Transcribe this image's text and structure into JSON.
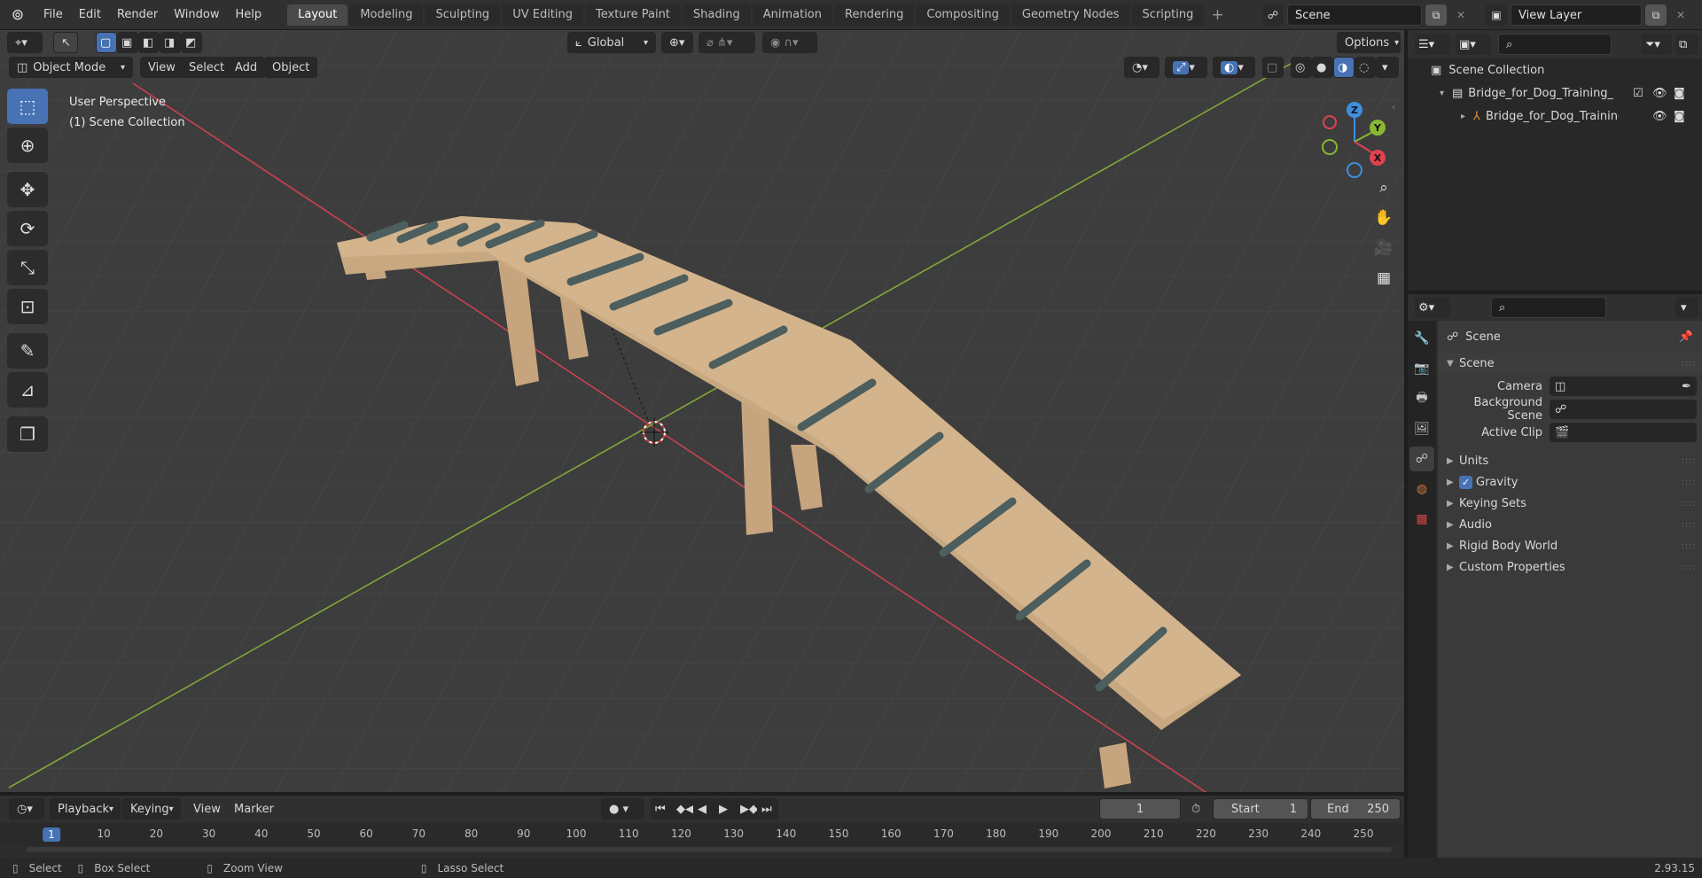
{
  "menu": {
    "items": [
      "File",
      "Edit",
      "Render",
      "Window",
      "Help"
    ]
  },
  "workspaces": [
    "Layout",
    "Modeling",
    "Sculpting",
    "UV Editing",
    "Texture Paint",
    "Shading",
    "Animation",
    "Rendering",
    "Compositing",
    "Geometry Nodes",
    "Scripting"
  ],
  "workspace_active": "Layout",
  "scene": {
    "name": "Scene",
    "view_layer": "View Layer"
  },
  "viewport": {
    "mode": "Object Mode",
    "menus": [
      "View",
      "Select",
      "Add",
      "Object"
    ],
    "transform_orientation": "Global",
    "options_label": "Options",
    "overlay_line1": "User Perspective",
    "overlay_line2": "(1) Scene Collection",
    "gizmo_axes": {
      "x": "X",
      "y": "Y",
      "z": "Z"
    }
  },
  "outliner": {
    "root": "Scene Collection",
    "collection": "Bridge_for_Dog_Training_Park",
    "object": "Bridge_for_Dog_Training"
  },
  "properties": {
    "breadcrumb": "Scene",
    "panel_scene": "Scene",
    "camera_label": "Camera",
    "background_scene_label": "Background Scene",
    "active_clip_label": "Active Clip",
    "sections": [
      "Units",
      "Gravity",
      "Keying Sets",
      "Audio",
      "Rigid Body World",
      "Custom Properties"
    ],
    "gravity_checked": true
  },
  "timeline": {
    "menus": [
      "Playback",
      "Keying",
      "View",
      "Marker"
    ],
    "current_frame": "1",
    "start_label": "Start",
    "start_value": "1",
    "end_label": "End",
    "end_value": "250",
    "ruler": [
      "1",
      "10",
      "20",
      "30",
      "40",
      "50",
      "60",
      "70",
      "80",
      "90",
      "100",
      "110",
      "120",
      "130",
      "140",
      "150",
      "160",
      "170",
      "180",
      "190",
      "200",
      "210",
      "220",
      "230",
      "240",
      "250"
    ]
  },
  "statusbar": {
    "select": "Select",
    "box_select": "Box Select",
    "zoom_view": "Zoom View",
    "lasso_select": "Lasso Select",
    "version": "2.93.15"
  },
  "colors": {
    "accent": "#4772b3",
    "x_axis": "#e0424f",
    "y_axis": "#8ab633",
    "z_axis": "#3e8fe0",
    "wood": "#d1b08b"
  }
}
